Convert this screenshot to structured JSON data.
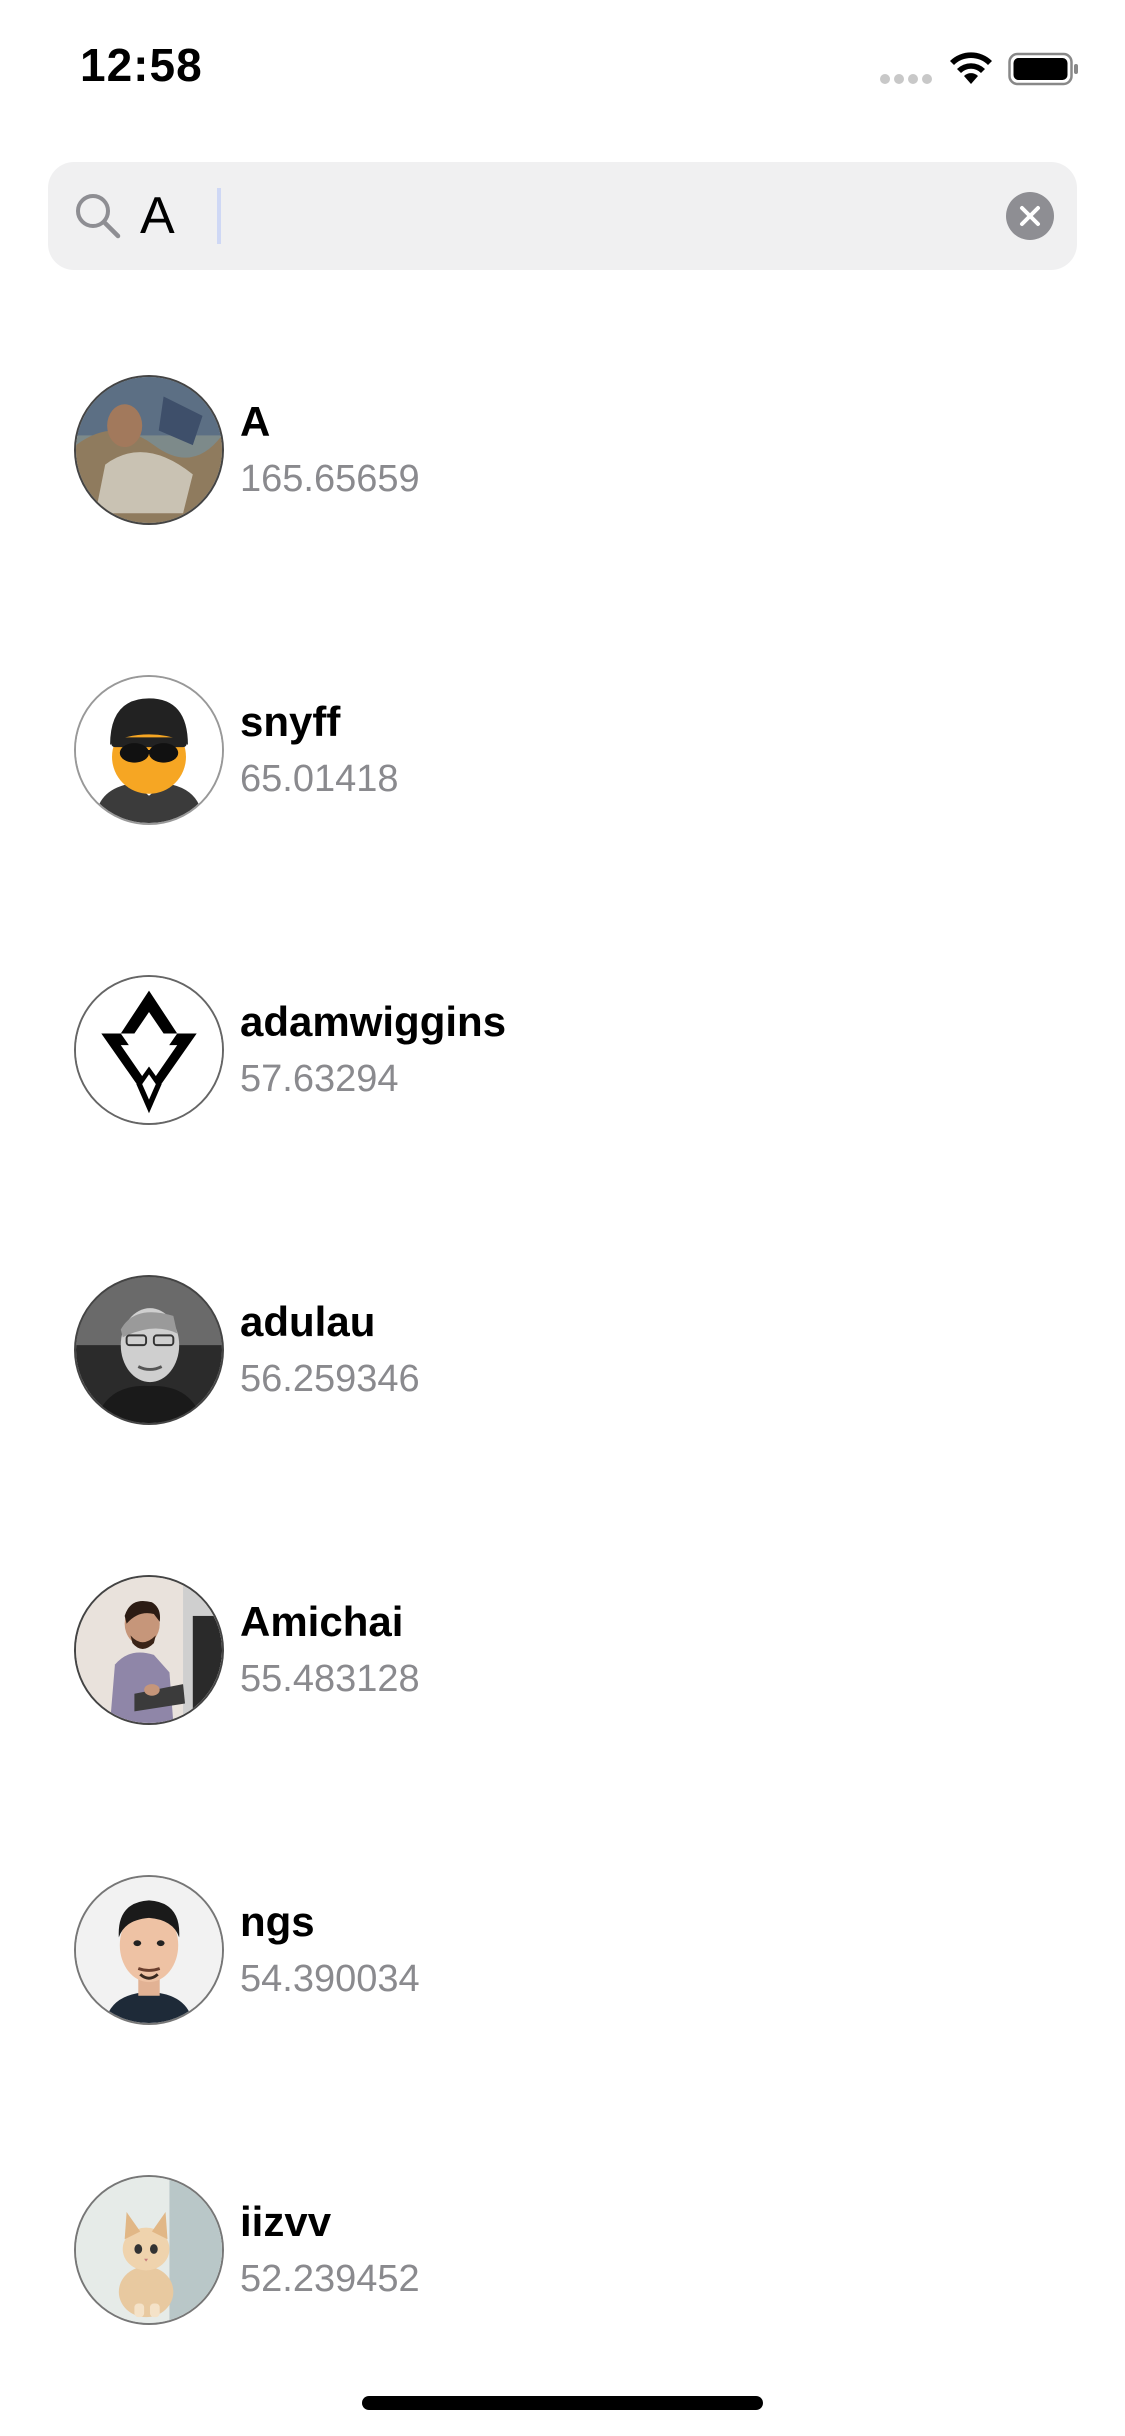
{
  "status_bar": {
    "time": "12:58"
  },
  "search": {
    "value": "A",
    "icon": "magnifying-glass",
    "clear_icon": "x-circle"
  },
  "results": [
    {
      "name": "A",
      "score": "165.65659",
      "avatar": "painting"
    },
    {
      "name": "snyff",
      "score": "65.01418",
      "avatar": "cartoon-sunglasses-beanie"
    },
    {
      "name": "adamwiggins",
      "score": "57.63294",
      "avatar": "geometric-logo"
    },
    {
      "name": "adulau",
      "score": "56.259346",
      "avatar": "bw-portrait-glasses"
    },
    {
      "name": "Amichai",
      "score": "55.483128",
      "avatar": "person-presenting"
    },
    {
      "name": "ngs",
      "score": "54.390034",
      "avatar": "portrait-man"
    },
    {
      "name": "iizvv",
      "score": "52.239452",
      "avatar": "kitten"
    }
  ],
  "colors": {
    "search_background": "#f0f0f1",
    "secondary_text": "#8a8a8e",
    "clear_button": "#8e8e93"
  }
}
